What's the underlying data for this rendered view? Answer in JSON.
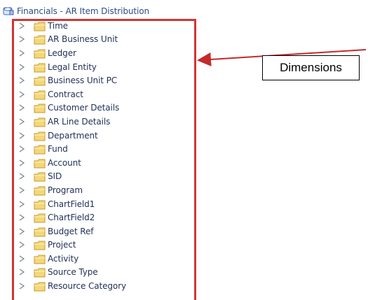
{
  "panel": {
    "title": "Financials - AR Item Distribution",
    "title_icon": "subject-area-icon",
    "items": [
      {
        "label": "Time",
        "icon": "folder-icon",
        "expander": "expand-triangle-icon"
      },
      {
        "label": "AR Business Unit",
        "icon": "folder-icon",
        "expander": "expand-triangle-icon"
      },
      {
        "label": "Ledger",
        "icon": "folder-icon",
        "expander": "expand-triangle-icon"
      },
      {
        "label": "Legal Entity",
        "icon": "folder-icon",
        "expander": "expand-triangle-icon"
      },
      {
        "label": "Business Unit PC",
        "icon": "folder-icon",
        "expander": "expand-triangle-icon"
      },
      {
        "label": "Contract",
        "icon": "folder-icon",
        "expander": "expand-triangle-icon"
      },
      {
        "label": "Customer Details",
        "icon": "folder-icon",
        "expander": "expand-triangle-icon"
      },
      {
        "label": "AR Line Details",
        "icon": "folder-icon",
        "expander": "expand-triangle-icon"
      },
      {
        "label": "Department",
        "icon": "folder-icon",
        "expander": "expand-triangle-icon"
      },
      {
        "label": "Fund",
        "icon": "folder-icon",
        "expander": "expand-triangle-icon"
      },
      {
        "label": "Account",
        "icon": "folder-icon",
        "expander": "expand-triangle-icon"
      },
      {
        "label": "SID",
        "icon": "folder-icon",
        "expander": "expand-triangle-icon"
      },
      {
        "label": "Program",
        "icon": "folder-icon",
        "expander": "expand-triangle-icon"
      },
      {
        "label": "ChartField1",
        "icon": "folder-icon",
        "expander": "expand-triangle-icon"
      },
      {
        "label": "ChartField2",
        "icon": "folder-icon",
        "expander": "expand-triangle-icon"
      },
      {
        "label": "Budget Ref",
        "icon": "folder-icon",
        "expander": "expand-triangle-icon"
      },
      {
        "label": "Project",
        "icon": "folder-icon",
        "expander": "expand-triangle-icon"
      },
      {
        "label": "Activity",
        "icon": "folder-icon",
        "expander": "expand-triangle-icon"
      },
      {
        "label": "Source Type",
        "icon": "folder-icon",
        "expander": "expand-triangle-icon"
      },
      {
        "label": "Resource Category",
        "icon": "folder-icon",
        "expander": "expand-triangle-icon"
      }
    ]
  },
  "annotation": {
    "label": "Dimensions"
  },
  "colors": {
    "highlight_border": "#d23434",
    "arrow": "#c42a2a",
    "header_text": "#2f4b86",
    "item_text": "#1f2f55",
    "folder_fill": "#f3d77a",
    "folder_stroke": "#c59a2d"
  }
}
